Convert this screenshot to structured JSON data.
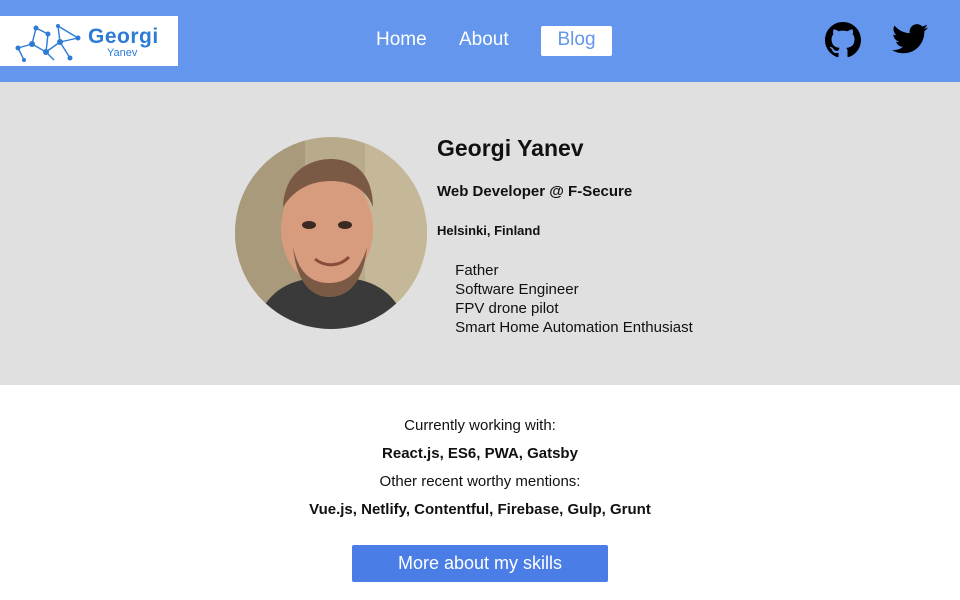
{
  "header": {
    "logo": {
      "name": "Georgi",
      "sub": "Yanev"
    },
    "nav": {
      "home": "Home",
      "about": "About",
      "blog": "Blog",
      "active": "Blog"
    },
    "social": {
      "github_icon": "github-icon",
      "twitter_icon": "twitter-icon"
    }
  },
  "profile": {
    "name": "Georgi Yanev",
    "role": "Web Developer @ F-Secure",
    "location": "Helsinki, Finland",
    "traits": [
      {
        "emoji": "",
        "text": "Father"
      },
      {
        "emoji": "",
        "text": "Software Engineer"
      },
      {
        "emoji": "",
        "text": "FPV drone pilot"
      },
      {
        "emoji": "",
        "text": "Smart Home Automation Enthusiast"
      }
    ]
  },
  "skills": {
    "current_label": "Currently working with:",
    "current_list": "React.js, ES6, PWA, Gatsby",
    "other_label": "Other recent worthy mentions:",
    "other_list": "Vue.js, Netlify, Contentful, Firebase, Gulp, Grunt",
    "button_label": "More about my skills"
  },
  "colors": {
    "header_bg": "#6396ec",
    "logo_text": "#2c7bd6",
    "profile_bg": "#e0e0e0",
    "button_bg": "#4a7de6"
  }
}
